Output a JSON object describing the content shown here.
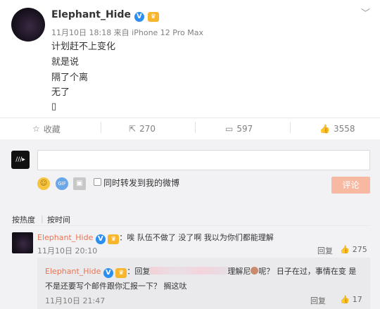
{
  "post": {
    "author": "Elephant_Hide",
    "meta": "11月10日 18:18 来自 iPhone 12 Pro Max",
    "lines": [
      "计划赶不上变化",
      "就是说",
      "隔了个离",
      "无了",
      "▯"
    ]
  },
  "actions": {
    "favorite": "收藏",
    "repost": "270",
    "comment": "597",
    "like": "3558"
  },
  "composer": {
    "placeholder": "",
    "forward_label": "同时转发到我的微博",
    "submit": "评论"
  },
  "sort": {
    "hot": "按热度",
    "time": "按时间"
  },
  "comment": {
    "author": "Elephant_Hide",
    "text": "：唉 队伍不做了 没了啊 我以为你们都能理解",
    "time": "11月10日 20:10",
    "reply_label": "回复",
    "likes": "275"
  },
  "reply": {
    "author": "Elephant_Hide",
    "prefix": "：回复",
    "after_blur": "理解尼",
    "text_1": "呢？ 日子在过，事情在变 是",
    "text_2": "不是还要写个邮件跟你汇报一下？ 搁这呔",
    "time": "11月10日 21:47",
    "reply_label": "回复",
    "likes": "17"
  },
  "colors": {
    "link": "#eb7350",
    "verified": "#2a8ff0",
    "submit_disabled": "#f8b9a3"
  },
  "icons": [
    "star-icon",
    "repost-icon",
    "comment-icon",
    "like-icon",
    "emoji-icon",
    "gif-icon",
    "image-icon",
    "chevron-down-icon"
  ]
}
